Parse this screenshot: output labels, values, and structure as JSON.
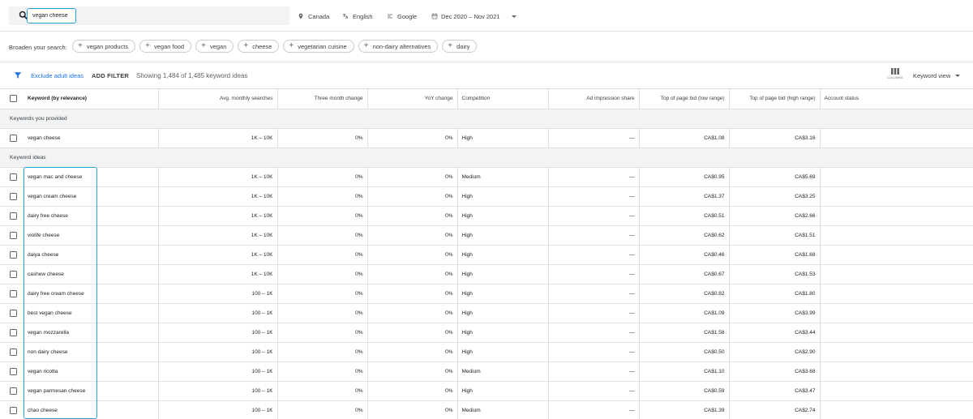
{
  "search": {
    "query": "vegan cheese"
  },
  "filters": {
    "location": "Canada",
    "language": "English",
    "network": "Google",
    "date_range": "Dec 2020 – Nov 2021"
  },
  "broaden": {
    "label": "Broaden your search:",
    "chips": [
      "vegan products",
      "vegan food",
      "vegan",
      "cheese",
      "vegetarian cuisine",
      "non-dairy alternatives",
      "dairy"
    ]
  },
  "toolbar": {
    "exclude_label": "Exclude adult ideas",
    "add_filter_label": "ADD FILTER",
    "showing_text": "Showing 1,484 of 1,485 keyword ideas",
    "columns_label": "COLUMNS",
    "view_label": "Keyword view"
  },
  "table": {
    "columns": [
      "Keyword (by relevance)",
      "Avg. monthly searches",
      "Three month change",
      "YoY change",
      "Competition",
      "Ad impression share",
      "Top of page bid (low range)",
      "Top of page bid (high range)",
      "Account status"
    ],
    "provided_label": "Keywords you provided",
    "ideas_label": "Keyword ideas",
    "provided_rows": [
      [
        "vegan cheese",
        "1K – 10K",
        "0%",
        "0%",
        "High",
        "—",
        "CA$1.08",
        "CA$3.16"
      ]
    ],
    "idea_rows": [
      [
        "vegan mac and cheese",
        "1K – 10K",
        "0%",
        "0%",
        "Medium",
        "—",
        "CA$0.95",
        "CA$5.69"
      ],
      [
        "vegan cream cheese",
        "1K – 10K",
        "0%",
        "0%",
        "High",
        "—",
        "CA$1.37",
        "CA$3.25"
      ],
      [
        "dairy free cheese",
        "1K – 10K",
        "0%",
        "0%",
        "High",
        "—",
        "CA$0.51",
        "CA$2.66"
      ],
      [
        "violife cheese",
        "1K – 10K",
        "0%",
        "0%",
        "High",
        "—",
        "CA$0.62",
        "CA$1.51"
      ],
      [
        "daiya cheese",
        "1K – 10K",
        "0%",
        "0%",
        "High",
        "—",
        "CA$0.46",
        "CA$1.68"
      ],
      [
        "cashew cheese",
        "1K – 10K",
        "0%",
        "0%",
        "High",
        "—",
        "CA$0.67",
        "CA$1.53"
      ],
      [
        "dairy free cream cheese",
        "100 – 1K",
        "0%",
        "0%",
        "High",
        "—",
        "CA$0.82",
        "CA$1.80"
      ],
      [
        "best vegan cheese",
        "100 – 1K",
        "0%",
        "0%",
        "High",
        "—",
        "CA$1.09",
        "CA$3.99"
      ],
      [
        "vegan mozzarella",
        "100 – 1K",
        "0%",
        "0%",
        "High",
        "—",
        "CA$1.58",
        "CA$3.44"
      ],
      [
        "non dairy cheese",
        "100 – 1K",
        "0%",
        "0%",
        "High",
        "—",
        "CA$0.50",
        "CA$2.90"
      ],
      [
        "vegan ricotta",
        "100 – 1K",
        "0%",
        "0%",
        "Medium",
        "—",
        "CA$1.10",
        "CA$3.68"
      ],
      [
        "vegan parmesan cheese",
        "100 – 1K",
        "0%",
        "0%",
        "High",
        "—",
        "CA$0.59",
        "CA$3.47"
      ],
      [
        "chao cheese",
        "100 – 1K",
        "0%",
        "0%",
        "Medium",
        "—",
        "CA$1.39",
        "CA$2.74"
      ]
    ]
  },
  "colors": {
    "accent": "#1a73e8",
    "highlight": "#29a3d6",
    "group_bg": "#f1f3f4"
  }
}
